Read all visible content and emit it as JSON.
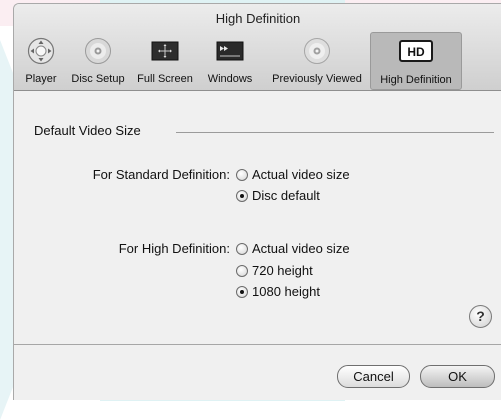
{
  "window": {
    "title": "High Definition"
  },
  "toolbar": {
    "items": [
      {
        "label": "Player",
        "icon": "player-icon",
        "selected": false
      },
      {
        "label": "Disc Setup",
        "icon": "disc-icon",
        "selected": false
      },
      {
        "label": "Full Screen",
        "icon": "full-screen-icon",
        "selected": false
      },
      {
        "label": "Windows",
        "icon": "windows-icon",
        "selected": false
      },
      {
        "label": "Previously Viewed",
        "icon": "disc-icon",
        "selected": false
      },
      {
        "label": "High Definition",
        "icon": "hd-icon",
        "icon_text": "HD",
        "selected": true
      }
    ]
  },
  "group": {
    "title": "Default Video Size"
  },
  "standard": {
    "label": "For Standard Definition:",
    "options": [
      {
        "label": "Actual video size",
        "checked": false
      },
      {
        "label": "Disc default",
        "checked": true
      }
    ]
  },
  "high": {
    "label": "For High Definition:",
    "options": [
      {
        "label": "Actual video size",
        "checked": false
      },
      {
        "label": "720 height",
        "checked": false
      },
      {
        "label": "1080 height",
        "checked": true
      }
    ]
  },
  "help": {
    "label": "?"
  },
  "buttons": {
    "cancel": "Cancel",
    "ok": "OK"
  }
}
